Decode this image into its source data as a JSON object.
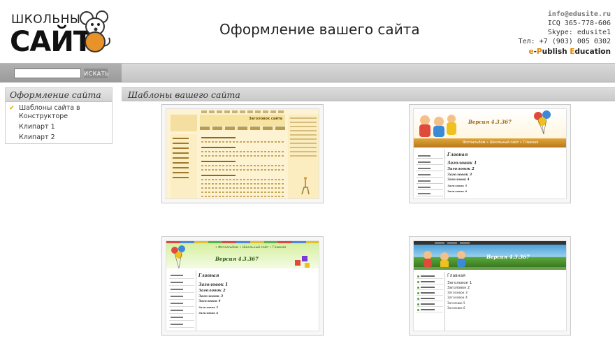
{
  "logo": {
    "top": "ШКОЛЬНЫЙ",
    "main": "САЙТ"
  },
  "site_title": "Оформление вашего сайта",
  "contacts": {
    "email": "info@edusite.ru",
    "icq": "ICQ 365-778-606",
    "skype": "Skype: edusite1",
    "phone": "Тел: +7 (903) 005 0302"
  },
  "brand": {
    "e": "e",
    "dash": "-",
    "p": "P",
    "ublish": "ublish ",
    "E": "E",
    "ducation": "ducation"
  },
  "search": {
    "value": "",
    "placeholder": "",
    "button": "ИСКАТЬ"
  },
  "sidebar": {
    "title": "Оформление сайта",
    "items": [
      {
        "label": "Шаблоны сайта в Конструкторе",
        "active": true
      },
      {
        "label": "Клипарт 1",
        "active": false
      },
      {
        "label": "Клипарт 2",
        "active": false
      }
    ]
  },
  "content": {
    "title": "Шаблоны вашего сайта"
  },
  "templates": [
    {
      "title": "Заголовок сайта"
    },
    {
      "version": "Версия 4.3.367",
      "breadcrumb": "Фотоальбом » Школьный сайт » Главная",
      "main": "Главная",
      "h1": "Заголовок 1",
      "h2": "Заголовок 2",
      "h3": "Заголовок 3",
      "h4": "Заголовок 4",
      "h5": "Заголовок 5",
      "h6": "Заголовок 6"
    },
    {
      "version": "Версия 4.3.367",
      "breadcrumb": "• Фотоальбом • Школьный сайт • Главная",
      "main": "Главная",
      "h1": "Заголовок 1",
      "h2": "Заголовок 2",
      "h3": "Заголовок 3",
      "h4": "Заголовок 4",
      "h5": "Заголовок 5",
      "h6": "Заголовок 6"
    },
    {
      "version": "Версия 4.3.367",
      "main": "Главная",
      "h1": "Заголовок 1",
      "h2": "Заголовок 2",
      "h3": "Заголовок 3",
      "h4": "Заголовок 4",
      "h5": "Заголовок 5",
      "h6": "Заголовок 6"
    }
  ],
  "colors": {
    "accent": "#e08a00",
    "panel": "#d2d2d2",
    "check": "#e0a000"
  }
}
